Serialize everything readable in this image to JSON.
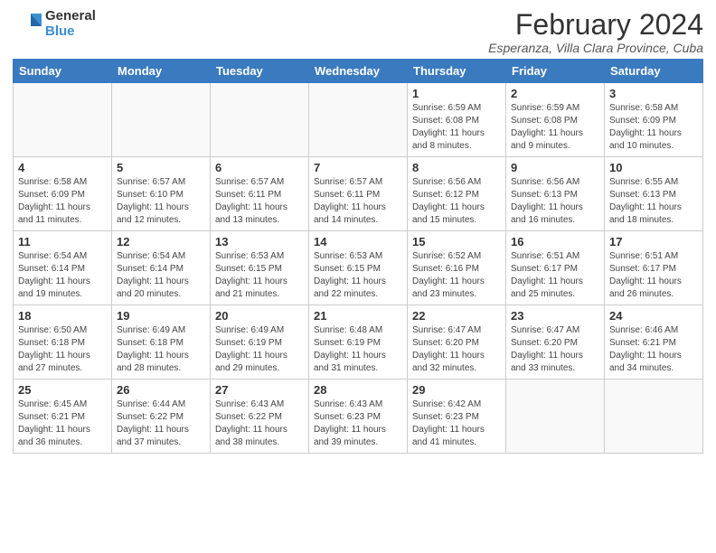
{
  "logo": {
    "general": "General",
    "blue": "Blue"
  },
  "title": "February 2024",
  "subtitle": "Esperanza, Villa Clara Province, Cuba",
  "days_of_week": [
    "Sunday",
    "Monday",
    "Tuesday",
    "Wednesday",
    "Thursday",
    "Friday",
    "Saturday"
  ],
  "weeks": [
    [
      {
        "day": "",
        "info": ""
      },
      {
        "day": "",
        "info": ""
      },
      {
        "day": "",
        "info": ""
      },
      {
        "day": "",
        "info": ""
      },
      {
        "day": "1",
        "info": "Sunrise: 6:59 AM\nSunset: 6:08 PM\nDaylight: 11 hours\nand 8 minutes."
      },
      {
        "day": "2",
        "info": "Sunrise: 6:59 AM\nSunset: 6:08 PM\nDaylight: 11 hours\nand 9 minutes."
      },
      {
        "day": "3",
        "info": "Sunrise: 6:58 AM\nSunset: 6:09 PM\nDaylight: 11 hours\nand 10 minutes."
      }
    ],
    [
      {
        "day": "4",
        "info": "Sunrise: 6:58 AM\nSunset: 6:09 PM\nDaylight: 11 hours\nand 11 minutes."
      },
      {
        "day": "5",
        "info": "Sunrise: 6:57 AM\nSunset: 6:10 PM\nDaylight: 11 hours\nand 12 minutes."
      },
      {
        "day": "6",
        "info": "Sunrise: 6:57 AM\nSunset: 6:11 PM\nDaylight: 11 hours\nand 13 minutes."
      },
      {
        "day": "7",
        "info": "Sunrise: 6:57 AM\nSunset: 6:11 PM\nDaylight: 11 hours\nand 14 minutes."
      },
      {
        "day": "8",
        "info": "Sunrise: 6:56 AM\nSunset: 6:12 PM\nDaylight: 11 hours\nand 15 minutes."
      },
      {
        "day": "9",
        "info": "Sunrise: 6:56 AM\nSunset: 6:13 PM\nDaylight: 11 hours\nand 16 minutes."
      },
      {
        "day": "10",
        "info": "Sunrise: 6:55 AM\nSunset: 6:13 PM\nDaylight: 11 hours\nand 18 minutes."
      }
    ],
    [
      {
        "day": "11",
        "info": "Sunrise: 6:54 AM\nSunset: 6:14 PM\nDaylight: 11 hours\nand 19 minutes."
      },
      {
        "day": "12",
        "info": "Sunrise: 6:54 AM\nSunset: 6:14 PM\nDaylight: 11 hours\nand 20 minutes."
      },
      {
        "day": "13",
        "info": "Sunrise: 6:53 AM\nSunset: 6:15 PM\nDaylight: 11 hours\nand 21 minutes."
      },
      {
        "day": "14",
        "info": "Sunrise: 6:53 AM\nSunset: 6:15 PM\nDaylight: 11 hours\nand 22 minutes."
      },
      {
        "day": "15",
        "info": "Sunrise: 6:52 AM\nSunset: 6:16 PM\nDaylight: 11 hours\nand 23 minutes."
      },
      {
        "day": "16",
        "info": "Sunrise: 6:51 AM\nSunset: 6:17 PM\nDaylight: 11 hours\nand 25 minutes."
      },
      {
        "day": "17",
        "info": "Sunrise: 6:51 AM\nSunset: 6:17 PM\nDaylight: 11 hours\nand 26 minutes."
      }
    ],
    [
      {
        "day": "18",
        "info": "Sunrise: 6:50 AM\nSunset: 6:18 PM\nDaylight: 11 hours\nand 27 minutes."
      },
      {
        "day": "19",
        "info": "Sunrise: 6:49 AM\nSunset: 6:18 PM\nDaylight: 11 hours\nand 28 minutes."
      },
      {
        "day": "20",
        "info": "Sunrise: 6:49 AM\nSunset: 6:19 PM\nDaylight: 11 hours\nand 29 minutes."
      },
      {
        "day": "21",
        "info": "Sunrise: 6:48 AM\nSunset: 6:19 PM\nDaylight: 11 hours\nand 31 minutes."
      },
      {
        "day": "22",
        "info": "Sunrise: 6:47 AM\nSunset: 6:20 PM\nDaylight: 11 hours\nand 32 minutes."
      },
      {
        "day": "23",
        "info": "Sunrise: 6:47 AM\nSunset: 6:20 PM\nDaylight: 11 hours\nand 33 minutes."
      },
      {
        "day": "24",
        "info": "Sunrise: 6:46 AM\nSunset: 6:21 PM\nDaylight: 11 hours\nand 34 minutes."
      }
    ],
    [
      {
        "day": "25",
        "info": "Sunrise: 6:45 AM\nSunset: 6:21 PM\nDaylight: 11 hours\nand 36 minutes."
      },
      {
        "day": "26",
        "info": "Sunrise: 6:44 AM\nSunset: 6:22 PM\nDaylight: 11 hours\nand 37 minutes."
      },
      {
        "day": "27",
        "info": "Sunrise: 6:43 AM\nSunset: 6:22 PM\nDaylight: 11 hours\nand 38 minutes."
      },
      {
        "day": "28",
        "info": "Sunrise: 6:43 AM\nSunset: 6:23 PM\nDaylight: 11 hours\nand 39 minutes."
      },
      {
        "day": "29",
        "info": "Sunrise: 6:42 AM\nSunset: 6:23 PM\nDaylight: 11 hours\nand 41 minutes."
      },
      {
        "day": "",
        "info": ""
      },
      {
        "day": "",
        "info": ""
      }
    ]
  ]
}
